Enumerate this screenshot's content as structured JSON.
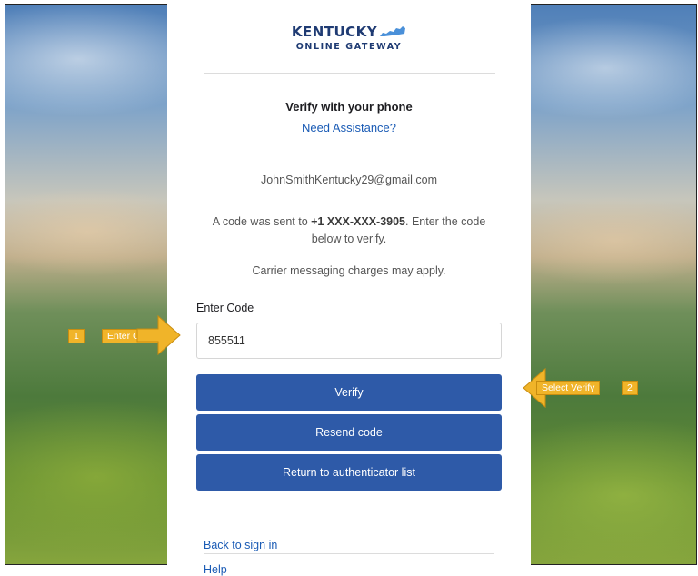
{
  "logo": {
    "line1": "KENTUCKY",
    "line2": "ONLINE GATEWAY",
    "icon": "kentucky-state-shape-icon",
    "color": "#1f3b73",
    "accent": "#4a90d9"
  },
  "heading": {
    "title": "Verify with your phone",
    "assist_link": "Need Assistance?"
  },
  "account": {
    "email": "JohnSmithKentucky29@gmail.com"
  },
  "message": {
    "prefix": "A code was sent to ",
    "phone": "+1 XXX-XXX-3905",
    "suffix": ". Enter the code below to verify.",
    "carrier_note": "Carrier messaging charges may apply."
  },
  "code_field": {
    "label": "Enter Code",
    "value": "855511"
  },
  "buttons": {
    "verify": "Verify",
    "resend": "Resend code",
    "return": "Return to authenticator list"
  },
  "footer": {
    "back_link": "Back to sign in",
    "help_link": "Help"
  },
  "annotations": {
    "step1_number": "1",
    "step1_label": "Enter Code",
    "step2_label": "Select Verify",
    "step2_number": "2",
    "color": "#f0b429"
  },
  "colors": {
    "button": "#2e5aa8",
    "link": "#1a5bb5"
  }
}
